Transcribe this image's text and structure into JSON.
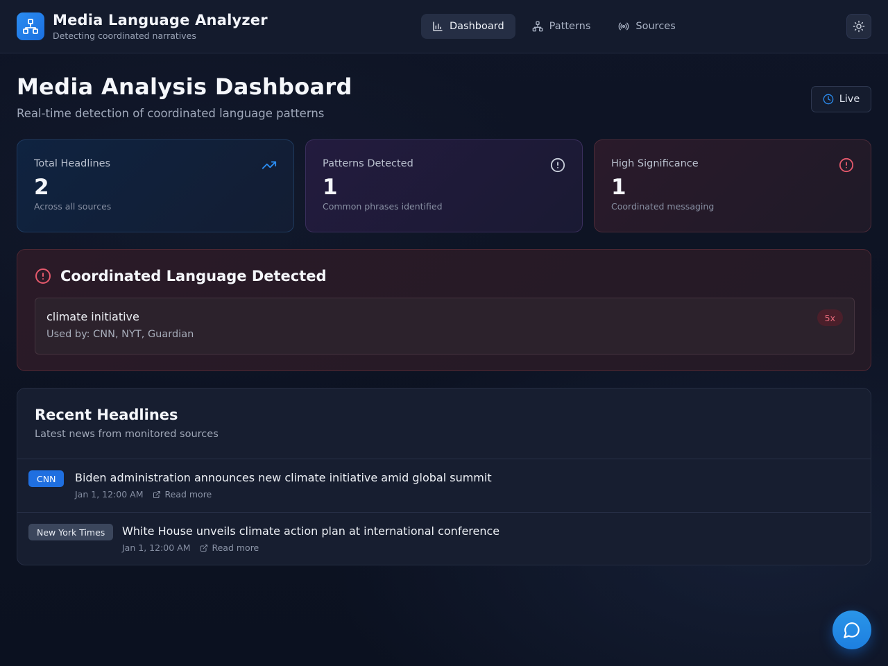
{
  "app": {
    "title": "Media Language Analyzer",
    "subtitle": "Detecting coordinated narratives",
    "logo_icon": "network-icon",
    "accent": "#2b8cf0"
  },
  "nav": {
    "items": [
      {
        "label": "Dashboard",
        "icon": "bar-chart-icon",
        "active": true
      },
      {
        "label": "Patterns",
        "icon": "network-icon",
        "active": false
      },
      {
        "label": "Sources",
        "icon": "radio-icon",
        "active": false
      }
    ],
    "theme_toggle_icon": "sun-icon"
  },
  "page": {
    "title": "Media Analysis Dashboard",
    "subtitle": "Real-time detection of coordinated language patterns",
    "live_label": "Live",
    "live_icon": "clock-icon"
  },
  "stats": [
    {
      "label": "Total Headlines",
      "value": "2",
      "note": "Across all sources",
      "icon": "trending-up-icon",
      "color": "#2b8cf0"
    },
    {
      "label": "Patterns Detected",
      "value": "1",
      "note": "Common phrases identified",
      "icon": "alert-circle-icon",
      "color": "#c9cfdb"
    },
    {
      "label": "High Significance",
      "value": "1",
      "note": "Coordinated messaging",
      "icon": "alert-circle-icon",
      "color": "#e5596c"
    }
  ],
  "coordinated": {
    "title": "Coordinated Language Detected",
    "icon": "alert-circle-icon",
    "patterns": [
      {
        "phrase": "climate initiative",
        "sources": "Used by: CNN, NYT, Guardian",
        "count": "5x"
      }
    ]
  },
  "headlines": {
    "title": "Recent Headlines",
    "subtitle": "Latest news from monitored sources",
    "items": [
      {
        "source": "CNN",
        "text": "Biden administration announces new climate initiative amid global summit",
        "time": "Jan 1, 12:00 AM",
        "link": "Read more"
      },
      {
        "source": "New York Times",
        "text": "White House unveils climate action plan at international conference",
        "time": "Jan 1, 12:00 AM",
        "link": "Read more"
      }
    ]
  },
  "chat": {
    "icon": "message-circle-icon"
  }
}
